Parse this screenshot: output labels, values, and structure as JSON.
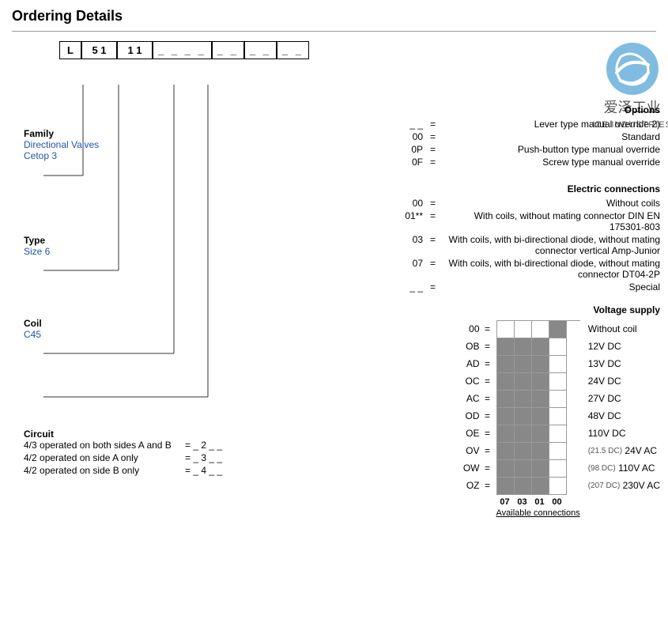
{
  "title": "Ordering Details",
  "code_segments": [
    "L",
    "5 1",
    "1 1",
    "_ _ _ _",
    "_ _",
    "_ _",
    "_ _"
  ],
  "logo": {
    "chinese": "爱泽工业",
    "english": "IZE INDUSTRIES"
  },
  "family": {
    "label": "Family",
    "line1": "Directional Valves",
    "line2": "Cetop 3"
  },
  "type": {
    "label": "Type",
    "value": "Size 6"
  },
  "coil": {
    "label": "Coil",
    "value": "C45"
  },
  "circuit": {
    "label": "Circuit",
    "rows": [
      {
        "desc": "4/3 operated on both sides A and B",
        "eq": "= _ 2 _ _"
      },
      {
        "desc": "4/2 operated on side A only",
        "eq": "= _ 3 _ _"
      },
      {
        "desc": "4/2 operated on side B only",
        "eq": "= _ 4 _ _"
      }
    ]
  },
  "options": {
    "title": "Options",
    "rows": [
      {
        "code": "_ _",
        "equals": "=",
        "desc": "Lever type manual override 2)"
      },
      {
        "code": "00",
        "equals": "=",
        "desc": "Standard"
      },
      {
        "code": "0P",
        "equals": "=",
        "desc": "Push-button type manual override"
      },
      {
        "code": "0F",
        "equals": "=",
        "desc": "Screw type manual override"
      }
    ]
  },
  "electric": {
    "title": "Electric connections",
    "rows": [
      {
        "code": "00",
        "equals": "=",
        "desc": "Without coils"
      },
      {
        "code": "01**",
        "equals": "=",
        "desc": "With coils, without mating connector DIN EN 175301-803"
      },
      {
        "code": "03",
        "equals": "=",
        "desc": "With coils, with bi-directional diode, without mating connector vertical Amp-Junior"
      },
      {
        "code": "07",
        "equals": "=",
        "desc": "With coils, with bi-directional diode, without mating connector DT04-2P"
      },
      {
        "code": "_ _",
        "equals": "=",
        "desc": "Special"
      }
    ]
  },
  "voltage": {
    "title": "Voltage supply",
    "rows": [
      {
        "code": "00",
        "desc": "Without coil",
        "note": ""
      },
      {
        "code": "OB",
        "desc": "12V DC",
        "note": ""
      },
      {
        "code": "AD",
        "desc": "13V DC",
        "note": ""
      },
      {
        "code": "OC",
        "desc": "24V DC",
        "note": ""
      },
      {
        "code": "AC",
        "desc": "27V DC",
        "note": ""
      },
      {
        "code": "OD",
        "desc": "48V DC",
        "note": ""
      },
      {
        "code": "OE",
        "desc": "110V DC",
        "note": ""
      },
      {
        "code": "OV",
        "desc": "24V AC",
        "note": "(21.5 DC)"
      },
      {
        "code": "OW",
        "desc": "110V AC",
        "note": "(98 DC)"
      },
      {
        "code": "OZ",
        "desc": "230V AC",
        "note": "(207 DC)"
      }
    ],
    "col_labels": [
      "07",
      "03",
      "01",
      "00"
    ],
    "avail_label": "Available connections",
    "grid": [
      [
        false,
        false,
        false,
        true
      ],
      [
        true,
        true,
        true,
        false
      ],
      [
        true,
        true,
        true,
        false
      ],
      [
        true,
        true,
        true,
        false
      ],
      [
        true,
        true,
        true,
        false
      ],
      [
        true,
        true,
        true,
        false
      ],
      [
        true,
        true,
        true,
        false
      ],
      [
        true,
        true,
        true,
        false
      ],
      [
        true,
        true,
        true,
        false
      ],
      [
        true,
        true,
        true,
        false
      ]
    ]
  }
}
